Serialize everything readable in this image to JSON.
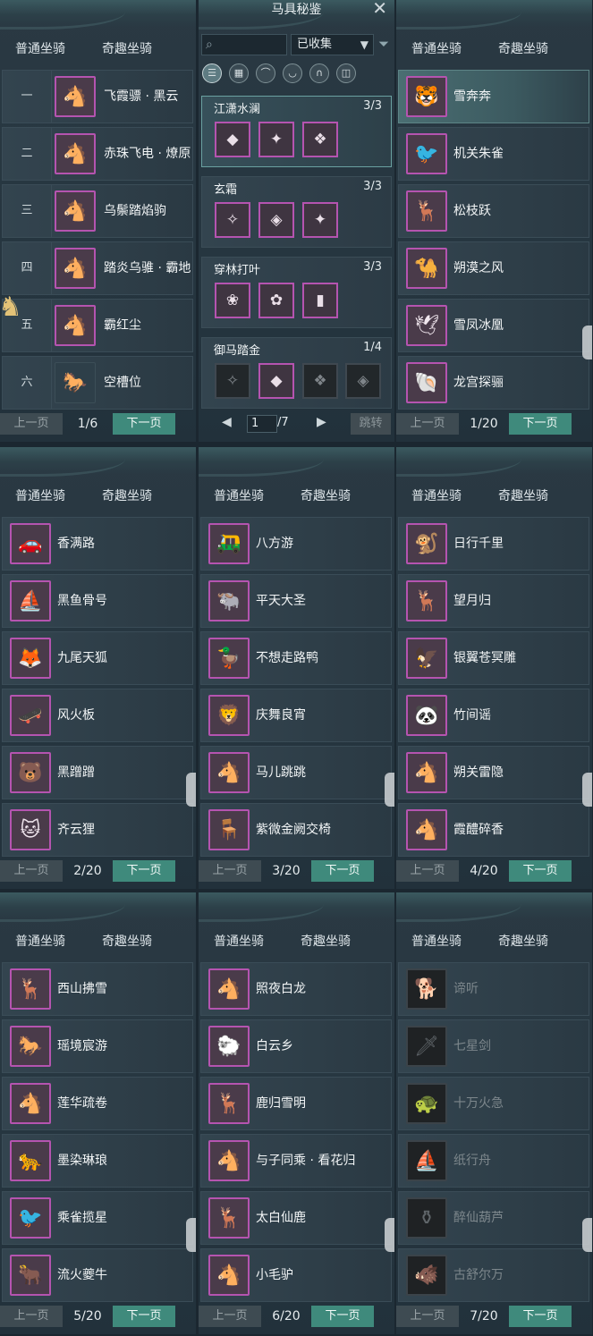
{
  "tabs": {
    "normal": "普通坐骑",
    "fun": "奇趣坐骑"
  },
  "pager": {
    "prev": "上一页",
    "next": "下一页"
  },
  "center": {
    "title": "马具秘鉴",
    "search_placeholder": "",
    "filter_value": "已收集",
    "page_current": "1",
    "page_total": "/7",
    "jump": "跳转",
    "sets": [
      {
        "name": "江潇水澜",
        "count": "3/3",
        "icons": [
          "◆",
          "✦",
          "❖"
        ]
      },
      {
        "name": "玄霜",
        "count": "3/3",
        "icons": [
          "✧",
          "◈",
          "✦"
        ]
      },
      {
        "name": "穿林打叶",
        "count": "3/3",
        "icons": [
          "❀",
          "✿",
          "▮"
        ]
      },
      {
        "name": "御马踏金",
        "count": "1/4",
        "icons": [
          "✧",
          "◆",
          "❖",
          "◈"
        ]
      }
    ]
  },
  "panels": [
    {
      "count": "1/6",
      "items": [
        {
          "num": "一",
          "label": "飞霞骠 · 黑云",
          "icon": "🐴"
        },
        {
          "num": "二",
          "label": "赤珠飞电 · 燎原",
          "icon": "🐴"
        },
        {
          "num": "三",
          "label": "乌鬃踏焰驹",
          "icon": "🐴"
        },
        {
          "num": "四",
          "label": "踏炎乌骓 · 霸地",
          "icon": "🐴"
        },
        {
          "num": "五",
          "label": "霸红尘",
          "icon": "🐴"
        },
        {
          "num": "六",
          "label": "空槽位",
          "icon": "🐎"
        }
      ]
    },
    {
      "count": "1/20",
      "items": [
        {
          "label": "雪奔奔",
          "icon": "🐯"
        },
        {
          "label": "机关朱雀",
          "icon": "🐦"
        },
        {
          "label": "松枝跃",
          "icon": "🦌"
        },
        {
          "label": "朔漠之风",
          "icon": "🐪"
        },
        {
          "label": "雪凤冰凰",
          "icon": "🕊"
        },
        {
          "label": "龙宫探骊",
          "icon": "🐚"
        }
      ]
    },
    {
      "count": "2/20",
      "items": [
        {
          "label": "香满路",
          "icon": "🚗"
        },
        {
          "label": "黑鱼骨号",
          "icon": "⛵"
        },
        {
          "label": "九尾天狐",
          "icon": "🦊"
        },
        {
          "label": "风火板",
          "icon": "🛹"
        },
        {
          "label": "黑蹭蹭",
          "icon": "🐻"
        },
        {
          "label": "齐云狸",
          "icon": "🐱"
        }
      ]
    },
    {
      "count": "3/20",
      "items": [
        {
          "label": "八方游",
          "icon": "🛺"
        },
        {
          "label": "平天大圣",
          "icon": "🐃"
        },
        {
          "label": "不想走路鸭",
          "icon": "🦆"
        },
        {
          "label": "庆舞良宵",
          "icon": "🦁"
        },
        {
          "label": "马儿跳跳",
          "icon": "🐴"
        },
        {
          "label": "紫微金阙交椅",
          "icon": "🪑"
        }
      ]
    },
    {
      "count": "4/20",
      "items": [
        {
          "label": "日行千里",
          "icon": "🐒"
        },
        {
          "label": "望月归",
          "icon": "🦌"
        },
        {
          "label": "银翼苍冥雕",
          "icon": "🦅"
        },
        {
          "label": "竹间谣",
          "icon": "🐼"
        },
        {
          "label": "朔关雷隐",
          "icon": "🐴"
        },
        {
          "label": "霞醴碎香",
          "icon": "🐴"
        }
      ]
    },
    {
      "count": "5/20",
      "items": [
        {
          "label": "西山拂雪",
          "icon": "🦌"
        },
        {
          "label": "瑶境宸游",
          "icon": "🐎"
        },
        {
          "label": "莲华疏卷",
          "icon": "🐴"
        },
        {
          "label": "墨染琳琅",
          "icon": "🐆"
        },
        {
          "label": "乘雀揽星",
          "icon": "🐦"
        },
        {
          "label": "流火夔牛",
          "icon": "🐂"
        }
      ]
    },
    {
      "count": "6/20",
      "items": [
        {
          "label": "照夜白龙",
          "icon": "🐴"
        },
        {
          "label": "白云乡",
          "icon": "🐑"
        },
        {
          "label": "鹿归雪明",
          "icon": "🦌"
        },
        {
          "label": "与子同乘 · 看花归",
          "icon": "🐴"
        },
        {
          "label": "太白仙鹿",
          "icon": "🦌"
        },
        {
          "label": "小毛驴",
          "icon": "🐴"
        }
      ]
    },
    {
      "count": "7/20",
      "items": [
        {
          "label": "谛听",
          "icon": "🐕"
        },
        {
          "label": "七星剑",
          "icon": "🗡"
        },
        {
          "label": "十万火急",
          "icon": "🐢"
        },
        {
          "label": "纸行舟",
          "icon": "⛵"
        },
        {
          "label": "醉仙葫芦",
          "icon": "⚱"
        },
        {
          "label": "古舒尔万",
          "icon": "🐗"
        }
      ]
    }
  ]
}
